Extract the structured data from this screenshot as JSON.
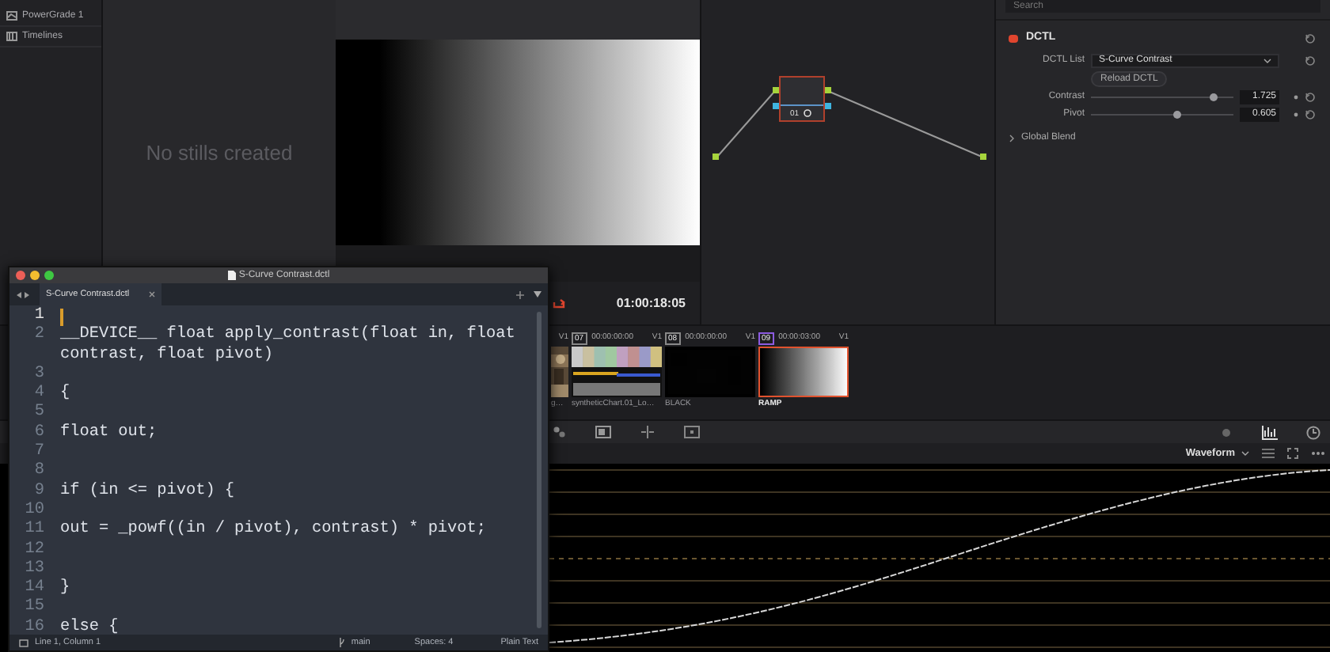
{
  "sidebar": {
    "items": [
      {
        "label": "PowerGrade 1",
        "kind": "grade"
      },
      {
        "label": "Timelines",
        "kind": "timeline"
      }
    ]
  },
  "gallery": {
    "empty_text": "No stills created"
  },
  "viewer": {
    "timecode": "01:00:18:05"
  },
  "node_graph": {
    "nodes": [
      {
        "label": "01"
      }
    ]
  },
  "inspector": {
    "search": {
      "placeholder": "Search"
    },
    "section": {
      "title": "DCTL",
      "enabled": true
    },
    "dctl_list": {
      "label": "DCTL List",
      "value": "S-Curve Contrast"
    },
    "reload_button": "Reload DCTL",
    "params": [
      {
        "label": "Contrast",
        "level": 0.86,
        "value": "1.725"
      },
      {
        "label": "Pivot",
        "level": 0.6,
        "value": "0.605"
      }
    ],
    "global_blend": {
      "label": "Global Blend",
      "expanded": false
    }
  },
  "clips": [
    {
      "track": "V1",
      "label": "g…",
      "selected": false
    },
    {
      "number": "07",
      "timecode": "00:00:00:00",
      "track": "V1",
      "label": "syntheticChart.01_Lo…",
      "kind": "chart",
      "selected": false
    },
    {
      "number": "08",
      "timecode": "00:00:00:00",
      "track": "V1",
      "label": "BLACK",
      "kind": "black",
      "selected": false
    },
    {
      "number": "09",
      "timecode": "00:00:03:00",
      "track": "V1",
      "label": "RAMP",
      "kind": "ramp",
      "selected": true
    }
  ],
  "scope": {
    "mode": "Waveform"
  },
  "editor": {
    "title": "S-Curve Contrast.dctl",
    "tabs": [
      {
        "label": "S-Curve Contrast.dctl",
        "selected": true
      }
    ],
    "lines": [
      {
        "number": "1",
        "current": true
      },
      {
        "number": "2",
        "code": "__DEVICE__ float apply_contrast(float in, float contrast, float pivot)",
        "current": false
      },
      {
        "number": "3",
        "current": false
      },
      {
        "number": "4",
        "code": "{",
        "current": false
      },
      {
        "number": "5",
        "current": false
      },
      {
        "number": "6",
        "code": "float out;",
        "current": false
      },
      {
        "number": "7",
        "current": false
      },
      {
        "number": "8",
        "current": false
      },
      {
        "number": "9",
        "code": "if (in <= pivot) {",
        "current": false
      },
      {
        "number": "10",
        "current": false
      },
      {
        "number": "11",
        "code": "out = _powf((in / pivot), contrast) * pivot;",
        "current": false
      },
      {
        "number": "12",
        "current": false
      },
      {
        "number": "13",
        "current": false
      },
      {
        "number": "14",
        "code": "}",
        "current": false
      },
      {
        "number": "15",
        "current": false
      },
      {
        "number": "16",
        "code": "else {",
        "current": false
      }
    ],
    "status": {
      "position": "Line 1, Column 1",
      "branch": "main",
      "indent": "Spaces: 4",
      "syntax": "Plain Text"
    }
  }
}
